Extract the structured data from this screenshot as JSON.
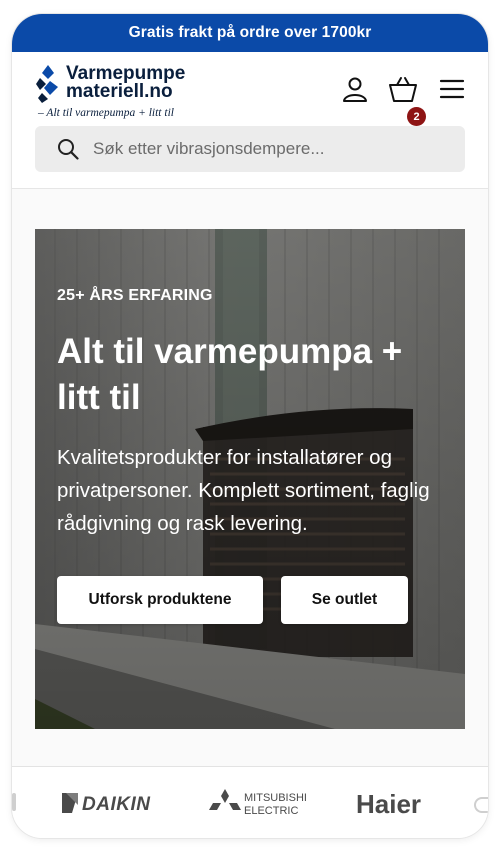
{
  "announcement": {
    "text": "Gratis frakt på ordre over 1700kr"
  },
  "header": {
    "logo": {
      "line1": "Varmepumpe",
      "line2": "materiell.no",
      "tagline": "– Alt til varmepumpa + litt til"
    },
    "cart_count": "2",
    "icons": [
      "user-icon",
      "cart-icon",
      "menu-icon"
    ]
  },
  "search": {
    "placeholder": "Søk etter vibrasjonsdempere..."
  },
  "hero": {
    "eyebrow": "25+ ÅRS ERFARING",
    "title": "Alt til varmepumpa + litt til",
    "subtitle": "Kvalitetsprodukter for installatører og privatpersoner. Komplett sortiment, faglig rådgivning og rask levering.",
    "primary_button": "Utforsk produktene",
    "secondary_button": "Se outlet"
  },
  "brands": {
    "daikin": "DAIKIN",
    "mitsubishi_line1": "MITSUBISHI",
    "mitsubishi_line2": "ELECTRIC",
    "haier": "Haier"
  },
  "colors": {
    "brand_blue": "#0b4aa8",
    "badge_red": "#8e1414",
    "logo_navy": "#0a1f3d"
  }
}
